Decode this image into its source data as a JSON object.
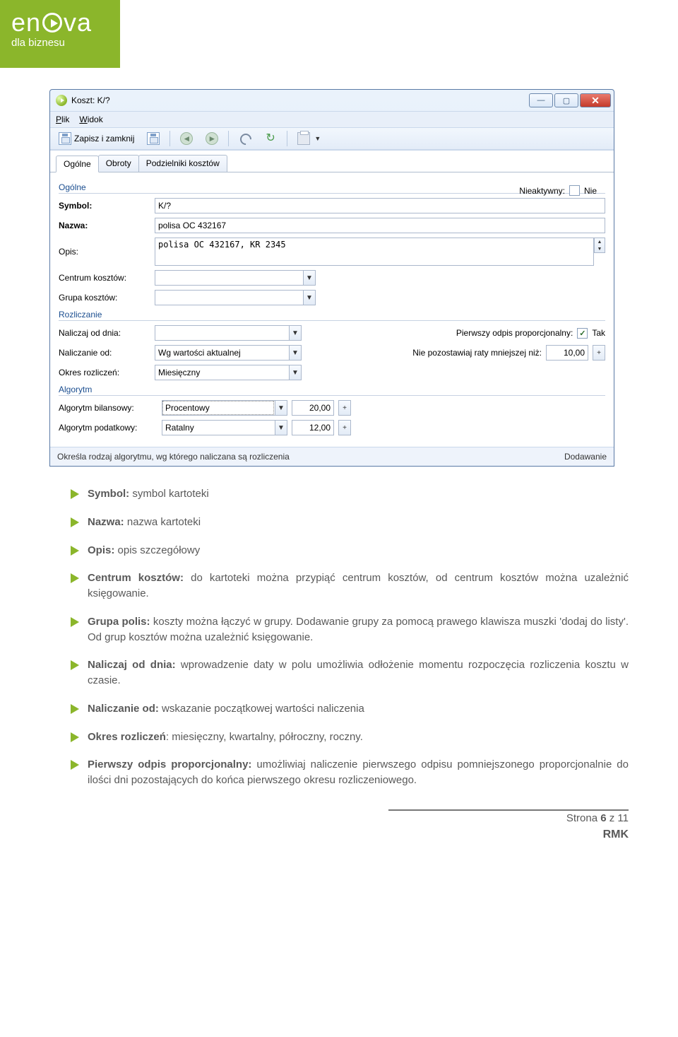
{
  "logo": {
    "main": "enva",
    "sub": "dla biznesu"
  },
  "window": {
    "title": "Koszt: K/?",
    "menu": {
      "plik": "Plik",
      "widok": "Widok"
    },
    "toolbar": {
      "save_close": "Zapisz i zamknij"
    },
    "tabs": {
      "ogolne": "Ogólne",
      "obroty": "Obroty",
      "podzielniki": "Podzielniki kosztów"
    },
    "ogolne": {
      "group": "Ogólne",
      "nieaktywny_lbl": "Nieaktywny:",
      "nieaktywny_val": "Nie",
      "symbol_lbl": "Symbol:",
      "symbol_val": "K/?",
      "nazwa_lbl": "Nazwa:",
      "nazwa_val": "polisa OC 432167",
      "opis_lbl": "Opis:",
      "opis_val": "polisa OC 432167, KR 2345",
      "centrum_lbl": "Centrum kosztów:",
      "centrum_val": "",
      "grupa_lbl": "Grupa kosztów:",
      "grupa_val": ""
    },
    "rozliczanie": {
      "group": "Rozliczanie",
      "naliczaj_lbl": "Naliczaj od dnia:",
      "naliczaj_val": "",
      "pierwszy_lbl": "Pierwszy odpis proporcjonalny:",
      "pierwszy_val": "Tak",
      "naliczanie_lbl": "Naliczanie od:",
      "naliczanie_val": "Wg wartości aktualnej",
      "niepoz_lbl": "Nie pozostawiaj raty mniejszej niż:",
      "niepoz_val": "10,00",
      "okres_lbl": "Okres rozliczeń:",
      "okres_val": "Miesięczny"
    },
    "algorytm": {
      "group": "Algorytm",
      "bil_lbl": "Algorytm bilansowy:",
      "bil_val": "Procentowy",
      "bil_num": "20,00",
      "pod_lbl": "Algorytm podatkowy:",
      "pod_val": "Ratalny",
      "pod_num": "12,00"
    },
    "status": {
      "left": "Określa rodzaj algorytmu, wg którego naliczana są rozliczenia",
      "right": "Dodawanie"
    }
  },
  "doc": {
    "i1b": "Symbol:",
    "i1": " symbol kartoteki",
    "i2b": "Nazwa:",
    "i2": " nazwa kartoteki",
    "i3b": "Opis:",
    "i3": " opis szczegółowy",
    "i4b": "Centrum kosztów:",
    "i4": " do kartoteki można przypiąć centrum kosztów, od centrum kosztów można uzależnić księgowanie.",
    "i5b": "Grupa polis:",
    "i5": " koszty można łączyć w grupy. Dodawanie grupy za pomocą prawego klawisza muszki 'dodaj do listy'. Od grup kosztów można uzależnić księgowanie.",
    "i6b": "Naliczaj od dnia:",
    "i6": " wprowadzenie daty w polu umożliwia odłożenie momentu rozpoczęcia rozliczenia kosztu w czasie.",
    "i7b": "Naliczanie od:",
    "i7": " wskazanie początkowej wartości naliczenia",
    "i8b": "Okres rozliczeń",
    "i8": ": miesięczny, kwartalny, półroczny, roczny.",
    "i9b": "Pierwszy odpis proporcjonalny:",
    "i9": " umożliwiaj naliczenie pierwszego odpisu pomniejszonego proporcjonalnie do ilości dni pozostających do końca pierwszego okresu rozliczeniowego."
  },
  "footer": {
    "page": "Strona 6 z 11",
    "pageNum": "6",
    "rmk": "RMK"
  }
}
